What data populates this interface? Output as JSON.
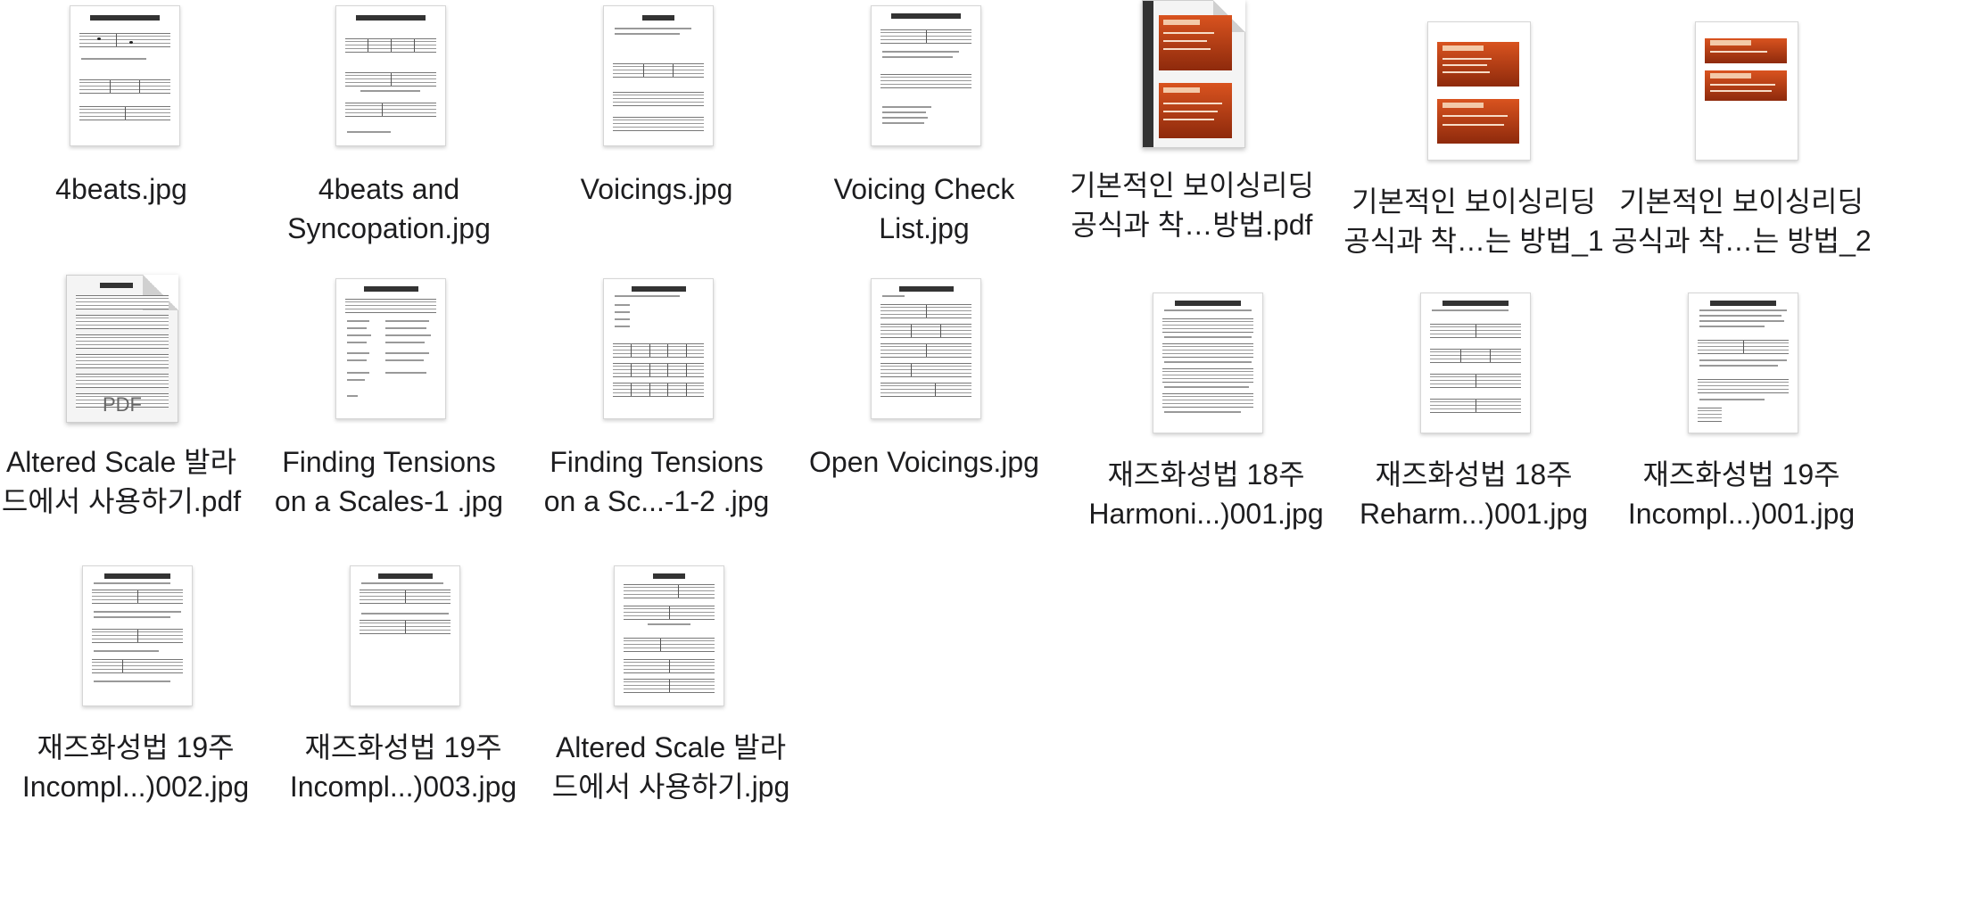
{
  "files": [
    {
      "label_line1": "4beats.jpg",
      "label_line2": "",
      "kind": "sheet-music-icon"
    },
    {
      "label_line1": "4beats and",
      "label_line2": "Syncopation.jpg",
      "kind": "sheet-music-icon"
    },
    {
      "label_line1": "Voicings.jpg",
      "label_line2": "",
      "kind": "sheet-music-icon"
    },
    {
      "label_line1": "Voicing Check",
      "label_line2": "List.jpg",
      "kind": "sheet-music-icon"
    },
    {
      "label_line1": "기본적인 보이싱리딩",
      "label_line2": "공식과 착…방법.pdf",
      "kind": "pdf-slides-icon"
    },
    {
      "label_line1": "기본적인 보이싱리딩",
      "label_line2": "공식과 착…는 방법_1",
      "kind": "slides-icon"
    },
    {
      "label_line1": "기본적인 보이싱리딩",
      "label_line2": "공식과 착…는 방법_2",
      "kind": "slides-icon"
    },
    {
      "label_line1": "Altered Scale 발라",
      "label_line2": "드에서 사용하기.pdf",
      "kind": "pdf-icon",
      "badge": "PDF"
    },
    {
      "label_line1": "Finding Tensions",
      "label_line2": "on a Scales-1 .jpg",
      "kind": "sheet-music-icon"
    },
    {
      "label_line1": "Finding Tensions",
      "label_line2": "on a Sc...-1-2 .jpg",
      "kind": "sheet-music-icon"
    },
    {
      "label_line1": "Open Voicings.jpg",
      "label_line2": "",
      "kind": "sheet-music-icon"
    },
    {
      "label_line1": "재즈화성법 18주",
      "label_line2": "Harmoni...)001.jpg",
      "kind": "sheet-music-icon"
    },
    {
      "label_line1": "재즈화성법 18주",
      "label_line2": "Reharm...)001.jpg",
      "kind": "sheet-music-icon"
    },
    {
      "label_line1": "재즈화성법 19주",
      "label_line2": "Incompl...)001.jpg",
      "kind": "sheet-music-icon"
    },
    {
      "label_line1": "재즈화성법 19주",
      "label_line2": "Incompl...)002.jpg",
      "kind": "sheet-music-icon"
    },
    {
      "label_line1": "재즈화성법 19주",
      "label_line2": "Incompl...)003.jpg",
      "kind": "sheet-music-icon"
    },
    {
      "label_line1": "Altered Scale 발라",
      "label_line2": "드에서 사용하기.jpg",
      "kind": "sheet-music-icon"
    }
  ]
}
